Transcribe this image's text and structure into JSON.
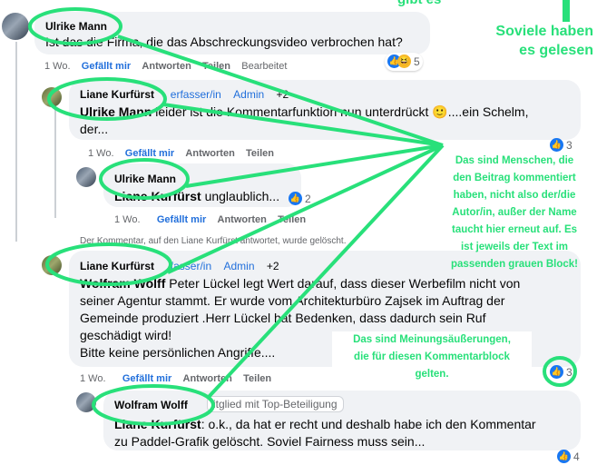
{
  "annotations": {
    "top_cut": "gibt es",
    "readers": "Soviele haben es gelesen",
    "readers_line1": "Soviele haben",
    "readers_line2": "es gelesen",
    "people_lines": [
      "Das sind Menschen, die",
      "den Beitrag kommentiert",
      "haben, nicht also der/die",
      "Autor/in, außer der Name",
      "taucht hier erneut auf. Es",
      "ist jeweils der Text im",
      "passenden grauen Block!"
    ],
    "opinion_lines": [
      "Das sind Meinungsäußerungen,",
      "die für diesen Kommentarblock",
      "gelten."
    ],
    "highlight_color": "#28e07a"
  },
  "comments": [
    {
      "author": "Ulrike Mann",
      "text": "Ist das die Firma, die das Abschreckungsvideo verbrochen hat?",
      "time": "1 Wo.",
      "like": "Gefällt mir",
      "reply": "Antworten",
      "share": "Teilen",
      "edited": "Bearbeitet",
      "reactions_count": "5"
    },
    {
      "author": "Liane Kurfürst",
      "role_partial": "erfasser/in",
      "admin": "Admin",
      "extra": "+2",
      "mention": "Ulrike Mann",
      "text": "leider ist die Kommentarfunktion nun unterdrückt",
      "emoji": "🙂",
      "text2": "....ein Schelm,",
      "text3": "der...",
      "time": "1 Wo.",
      "like": "Gefällt mir",
      "reply": "Antworten",
      "share": "Teilen",
      "reactions_count": "3"
    },
    {
      "author": "Ulrike Mann",
      "mention": "Liane Kurfürst",
      "text": "unglaublich...",
      "time": "1 Wo.",
      "like": "Gefällt mir",
      "reply": "Antworten",
      "share": "Teilen",
      "reactions_count": "2"
    },
    {
      "deleted_notice": "Der Kommentar, auf den Liane Kurfürst antwortet, wurde gelöscht."
    },
    {
      "author": "Liane Kurfürst",
      "role_partial": "fasser/in",
      "admin": "Admin",
      "extra": "+2",
      "mention": "Wolfram Wolff",
      "line1": "Peter Lückel legt Wert darauf, dass dieser Werbefilm nicht von",
      "line2": "seiner Agentur stammt. Er wurde vom Architekturbüro Zajsek im Auftrag der",
      "line3": "Gemeinde produziert .Herr Lückel hat Bedenken, dass dadurch sein Ruf",
      "line4": "geschädigt wird!",
      "line5": "Bitte keine persönlichen Angriffe....",
      "time": "1 Wo.",
      "like": "Gefällt mir",
      "reply": "Antworten",
      "share": "Teilen",
      "reactions_count": "3"
    },
    {
      "author": "Wolfram Wolff",
      "badge": "itglied mit Top-Beteiligung",
      "mention": "Liane Kurfürst",
      "line1": ": o.k., da hat er recht und deshalb habe ich den Kommentar",
      "line2": "zu Paddel-Grafik gelöscht. Soviel Fairness muss sein...",
      "reactions_count": "4"
    }
  ]
}
